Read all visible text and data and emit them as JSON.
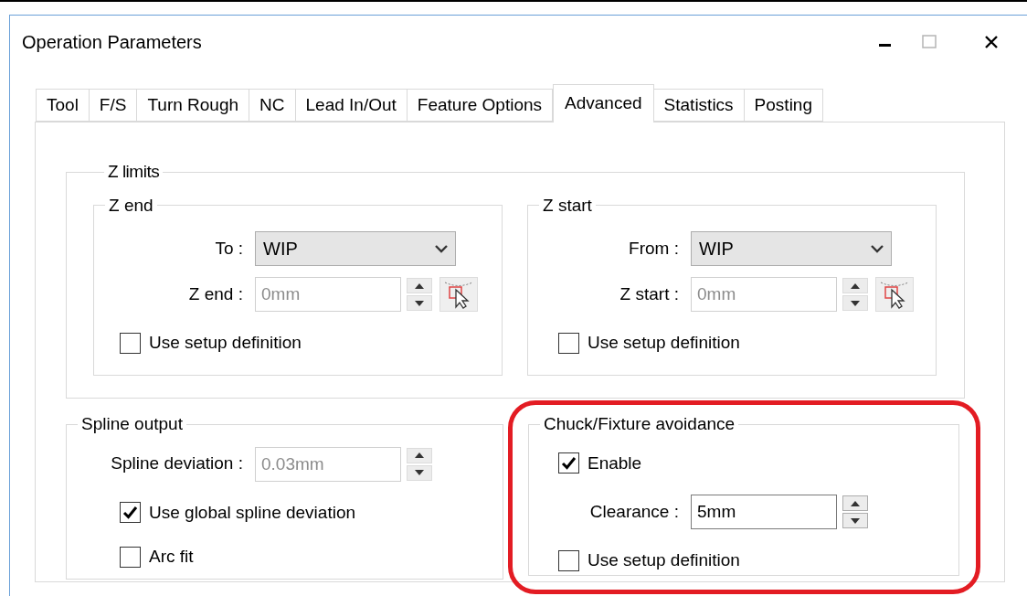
{
  "window": {
    "title": "Operation Parameters"
  },
  "tabs": [
    {
      "label": "Tool",
      "selected": false
    },
    {
      "label": "F/S",
      "selected": false
    },
    {
      "label": "Turn Rough",
      "selected": false
    },
    {
      "label": "NC",
      "selected": false
    },
    {
      "label": "Lead In/Out",
      "selected": false
    },
    {
      "label": "Feature Options",
      "selected": false
    },
    {
      "label": "Advanced",
      "selected": true
    },
    {
      "label": "Statistics",
      "selected": false
    },
    {
      "label": "Posting",
      "selected": false
    }
  ],
  "z_limits": {
    "title": "Z limits",
    "groups": [
      {
        "title": "Z end",
        "rows": [
          {
            "kind": "combo",
            "label": "To :",
            "value": "WIP"
          },
          {
            "kind": "pick_field",
            "label": "Z end :",
            "value": "0mm",
            "disabled": true
          },
          {
            "kind": "checkbox",
            "label": "Use setup definition",
            "checked": false
          }
        ]
      },
      {
        "title": "Z start",
        "rows": [
          {
            "kind": "combo",
            "label": "From :",
            "value": "WIP"
          },
          {
            "kind": "pick_field",
            "label": "Z start :",
            "value": "0mm",
            "disabled": true
          },
          {
            "kind": "checkbox",
            "label": "Use setup definition",
            "checked": false
          }
        ]
      }
    ]
  },
  "spline_output": {
    "title": "Spline output",
    "rows": [
      {
        "kind": "spin_field",
        "label": "Spline deviation :",
        "value": "0.03mm",
        "disabled": true
      },
      {
        "kind": "checkbox",
        "label": "Use global spline deviation",
        "checked": true
      },
      {
        "kind": "checkbox",
        "label": "Arc fit",
        "checked": false
      }
    ]
  },
  "chuck_fixture_avoidance": {
    "title": "Chuck/Fixture avoidance",
    "rows": [
      {
        "kind": "checkbox",
        "label": "Enable",
        "checked": true
      },
      {
        "kind": "spin_field",
        "label": "Clearance :",
        "value": "5mm",
        "disabled": false
      },
      {
        "kind": "checkbox",
        "label": "Use setup definition",
        "checked": false
      }
    ]
  }
}
